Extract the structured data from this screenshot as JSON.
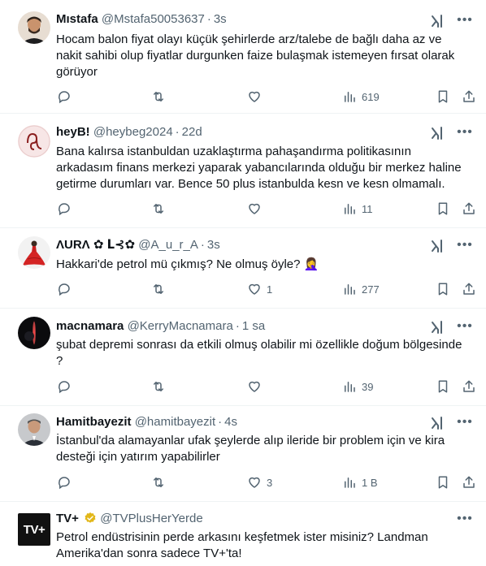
{
  "tweets": [
    {
      "name": "Mıstafa",
      "handle": "@Mstafa50053637",
      "time": "3s",
      "text": "Hocam balon fiyat olayı küçük şehirlerde arz/talebe de bağlı daha az ve nakit sahibi olup fiyatlar durgunken faize bulaşmak istemeyen fırsat olarak görüyor",
      "replies": "",
      "retweets": "",
      "likes": "",
      "views": "619"
    },
    {
      "name": "heyB!",
      "handle": "@heybeg2024",
      "time": "22d",
      "text": "Bana kalırsa istanbuldan uzaklaştırma pahaşandırma politikasının arkadasım finans merkezi yaparak yabancılarında olduğu bir merkez haline getirme durumları var. Bence 50 plus istanbulda kesn ve kesn olmamalı.",
      "replies": "",
      "retweets": "",
      "likes": "",
      "views": "11"
    },
    {
      "name": "ΛURΛ ✿ ᒪ⊰✿",
      "handle": "@A_u_r_A",
      "time": "3s",
      "text": "Hakkari'de petrol mü çıkmış? Ne olmuş öyle? 🤦‍♀️",
      "replies": "",
      "retweets": "",
      "likes": "1",
      "views": "277"
    },
    {
      "name": "macnamara",
      "handle": "@KerryMacnamara",
      "time": "1 sa",
      "text": "şubat depremi sonrası da etkili olmuş olabilir mi özellikle doğum bölgesinde ?",
      "replies": "",
      "retweets": "",
      "likes": "",
      "views": "39"
    },
    {
      "name": "Hamitbayezit",
      "handle": "@hamitbayezit",
      "time": "4s",
      "text": "İstanbul'da alamayanlar ufak şeylerde alıp ileride bir problem için ve kira desteği için yatırım yapabilirler",
      "replies": "",
      "retweets": "",
      "likes": "3",
      "views": "1 B"
    },
    {
      "name": "TV+",
      "handle": "@TVPlusHerYerde",
      "time": "",
      "text": "Petrol endüstrisinin perde arkasını keşfetmek ister misiniz? Landman Amerika'dan sonra sadece TV+'ta!",
      "avatar_label": "TV+"
    }
  ],
  "colors": {
    "text": "#0f1419",
    "secondary": "#536471",
    "border": "#eff3f4",
    "verified_gold": "#e2b719",
    "tvplus_bg": "#111111",
    "tvplus_plus": "#f6c200"
  }
}
